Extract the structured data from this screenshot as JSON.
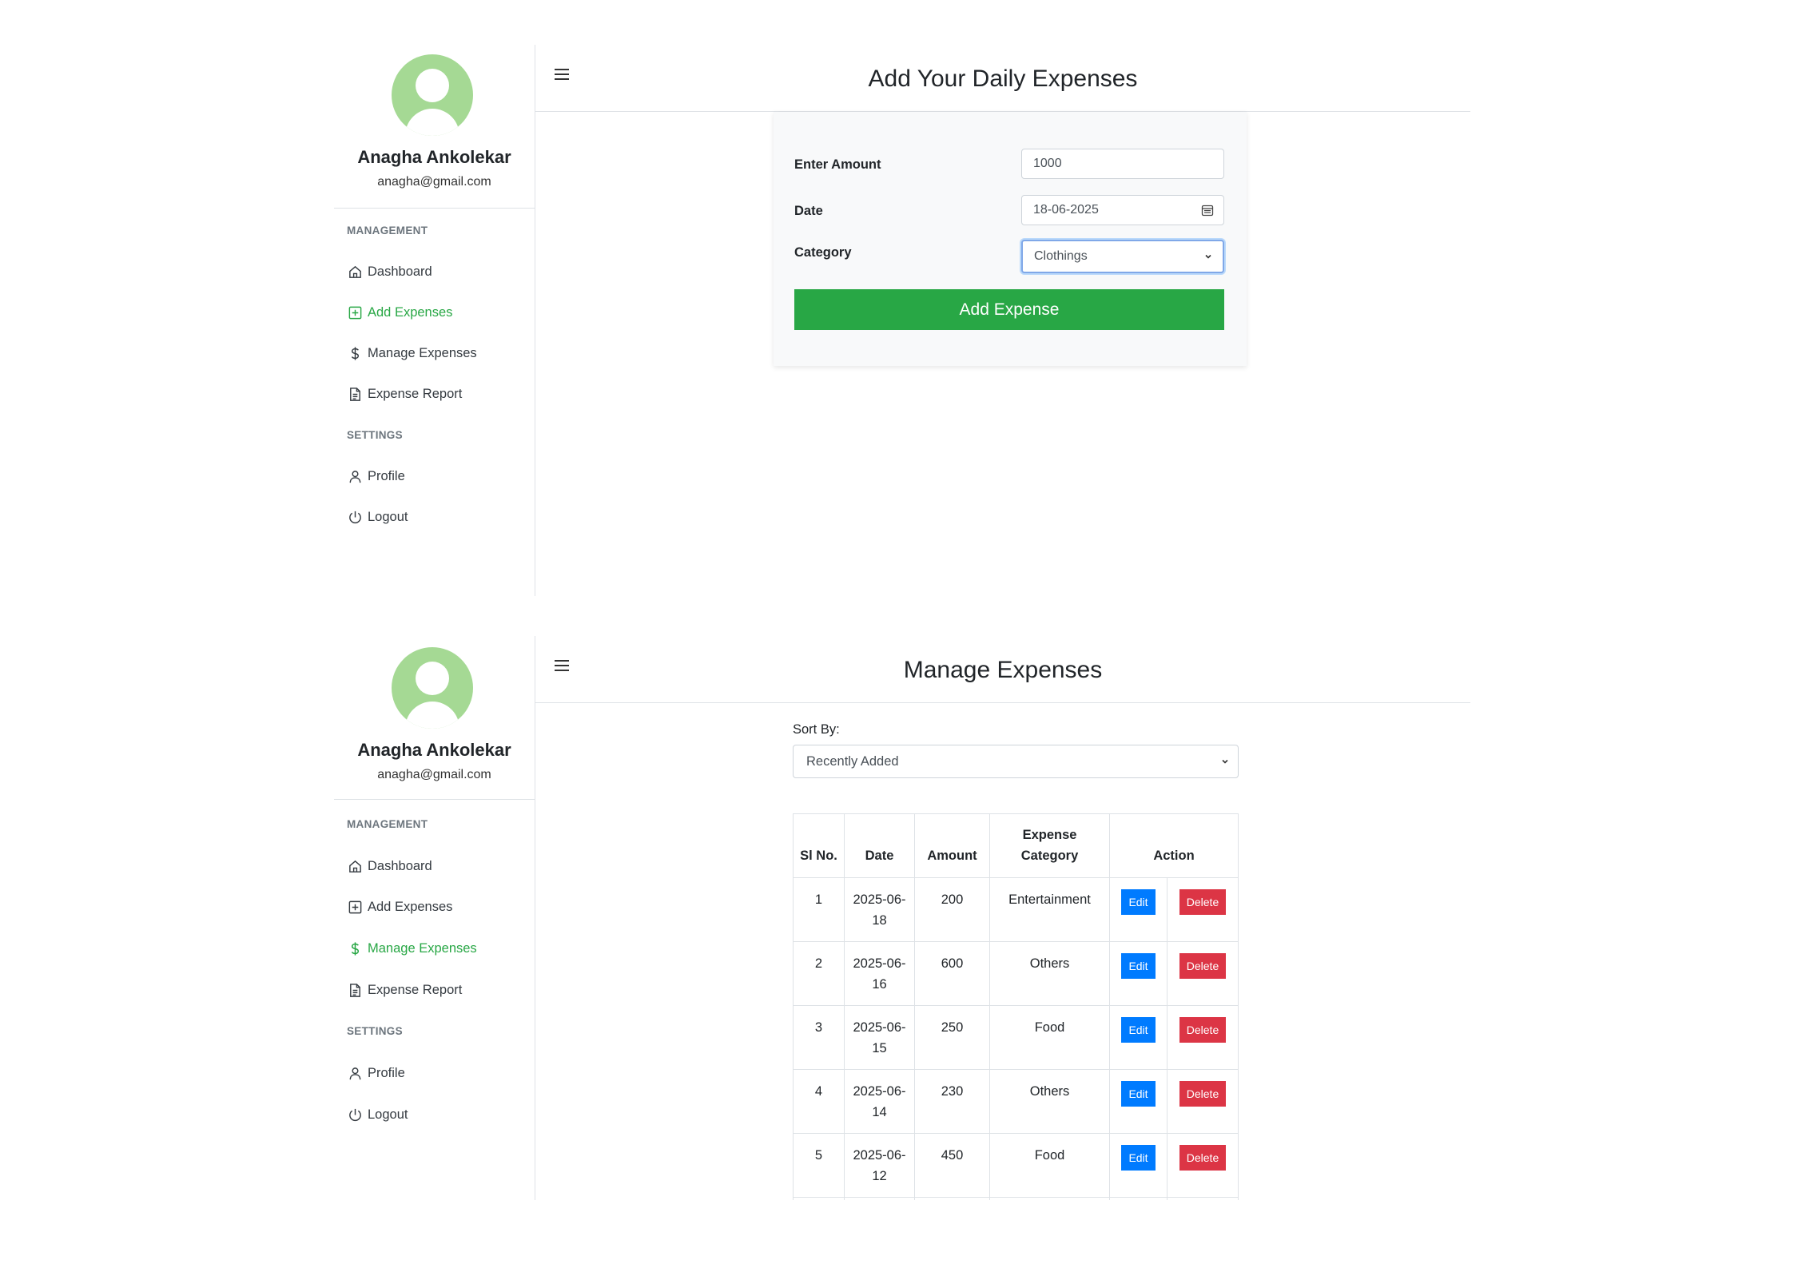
{
  "panels": [
    {
      "user": {
        "name": "Anagha Ankolekar",
        "email": "anagha@gmail.com"
      },
      "nav": {
        "management_label": "MANAGEMENT",
        "settings_label": "SETTINGS",
        "items": [
          "Dashboard",
          "Add Expenses",
          "Manage Expenses",
          "Expense Report",
          "Profile",
          "Logout"
        ]
      },
      "title": "Add Your Daily Expenses",
      "form": {
        "amount_label": "Enter Amount",
        "amount_value": "1000",
        "date_label": "Date",
        "date_value": "18-06-2025",
        "category_label": "Category",
        "category_value": "Clothings",
        "submit_label": "Add Expense"
      }
    },
    {
      "user": {
        "name": "Anagha Ankolekar",
        "email": "anagha@gmail.com"
      },
      "nav": {
        "management_label": "MANAGEMENT",
        "settings_label": "SETTINGS",
        "items": [
          "Dashboard",
          "Add Expenses",
          "Manage Expenses",
          "Expense Report",
          "Profile",
          "Logout"
        ]
      },
      "title": "Manage Expenses",
      "sort": {
        "label": "Sort By:",
        "value": "Recently Added"
      },
      "table": {
        "headers": [
          "Sl No.",
          "Date",
          "Amount",
          "Expense Category",
          "Action"
        ],
        "rows": [
          {
            "sl": "1",
            "date": "2025-06-18",
            "amount": "200",
            "category": "Entertainment"
          },
          {
            "sl": "2",
            "date": "2025-06-16",
            "amount": "600",
            "category": "Others"
          },
          {
            "sl": "3",
            "date": "2025-06-15",
            "amount": "250",
            "category": "Food"
          },
          {
            "sl": "4",
            "date": "2025-06-14",
            "amount": "230",
            "category": "Others"
          },
          {
            "sl": "5",
            "date": "2025-06-12",
            "amount": "450",
            "category": "Food"
          }
        ],
        "edit_label": "Edit",
        "delete_label": "Delete"
      }
    }
  ],
  "colors": {
    "accent_green": "#28a745",
    "edit_blue": "#007bff",
    "delete_red": "#dc3545",
    "avatar_green": "#a5d994"
  },
  "icons": [
    "menu-icon",
    "home-icon",
    "plus-square-icon",
    "dollar-icon",
    "document-icon",
    "user-icon",
    "power-icon",
    "calendar-icon",
    "chevron-down-icon"
  ]
}
